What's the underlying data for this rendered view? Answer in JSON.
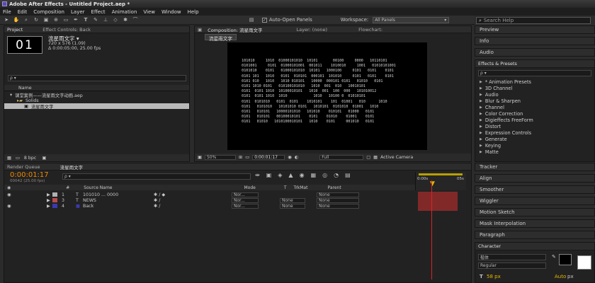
{
  "window": {
    "title": "Adobe After Effects - Untitled Project.aep *"
  },
  "menu": [
    "File",
    "Edit",
    "Composition",
    "Layer",
    "Effect",
    "Animation",
    "View",
    "Window",
    "Help"
  ],
  "toolbar": {
    "auto_open": "Auto-Open Panels",
    "workspace_label": "Workspace:",
    "workspace_value": "All Panels",
    "search": "Search Help"
  },
  "project": {
    "tab1": "Project",
    "tab2": "Effect Controls: Back",
    "comp_name": "流星雨文字 ▾",
    "thumb_text": "01",
    "size_info": "720 x 576 (1.09)",
    "dur_info": "Δ 0:00:05:00, 25.00 fps",
    "search_ph": "ρ ▾",
    "col_name": "Name",
    "items": [
      {
        "label": "课堂案例——流星雨文字动画.aep"
      },
      {
        "label": "Solids"
      },
      {
        "label": "流星雨文字"
      }
    ],
    "bpc": "8 bpc"
  },
  "composition": {
    "tab": "Composition: 流星雨文字",
    "layer_tab": "Layer: (none)",
    "flowchart_tab": "Flowchart:",
    "comp_tab": "流星雨文字",
    "zoom": "50%",
    "timecode": "0:00:01:17",
    "res": "Full",
    "camera": "Active Camera",
    "matrix": [
      "  101010     1010  01000101010  10101       00100     0000   10110101 ",
      "  0101001     0101  01000101001  001011    1010010     1001   01010101001",
      "  0101010    0101   01000101010  10101   1000100     0101   0101    0101",
      "  0101 101   1010   0101  010101  000101  101010     0101   0101    0101",
      "  0101 010   1010   1010 010101   10000  000101 0101   01010   0101",
      "  0101 1010 0101   010100101010   1010  001  010   10010101",
      "  0101  0101 1010  10100010101   1010  001  100  000   101010012",
      "  0101  0101 1010  1010            1010   10100 0  01010101",
      "  0101  0101010   0101  0101    1010101    101  01001   010      1010",
      "  0101   0101010   10101010 0101   1010101  0101010  01001   1010",
      "  0101   010101   10000101010   101010    010101   01000   0101",
      "  0101   010101   00100010101    0101    01010    01001    0101",
      "  0101   01010   1010100010101   1010    0101     001010   0101"
    ]
  },
  "right": {
    "preview": "Preview",
    "info": "Info",
    "audio": "Audio",
    "effects_title": "Effects & Presets",
    "effects": [
      "* Animation Presets",
      "3D Channel",
      "Audio",
      "Blur & Sharpen",
      "Channel",
      "Color Correction",
      "Digieffects FreeForm",
      "Distort",
      "Expression Controls",
      "Generate",
      "Keying",
      "Matte"
    ],
    "tracker": "Tracker",
    "align": "Align",
    "smoother": "Smoother",
    "wiggler": "Wiggler",
    "motion_sketch": "Motion Sketch",
    "mask_interp": "Mask Interpolation",
    "paragraph": "Paragraph",
    "character": "Character",
    "font": "楷体",
    "style": "Regular",
    "font_size": "58 px",
    "auto": "Auto",
    "px": "px"
  },
  "timeline": {
    "render_tab": "Render Queue",
    "comp_tab": "流星雨文字",
    "timecode": "0:00:01:17",
    "subtime": "00042 (25.00 fps)",
    "col_num": "#",
    "col_source": "Source Name",
    "col_mode": "Mode",
    "col_t": "T",
    "col_trk": "TrkMat",
    "col_parent": "Parent",
    "ruler_start": "0:00s",
    "ruler_end": "05s",
    "layers": [
      {
        "num": "1",
        "name": "101010 ... 0000",
        "color": "#b0b0b0",
        "mode": "Nor...",
        "trk": "",
        "parent": "None"
      },
      {
        "num": "3",
        "name": "NEWS",
        "color": "#b84a4a",
        "mode": "Nor...",
        "trk": "None",
        "parent": "None"
      },
      {
        "num": "4",
        "name": "Back",
        "color": "#3a3ab0",
        "mode": "Nor...",
        "trk": "None",
        "parent": "None"
      }
    ]
  }
}
